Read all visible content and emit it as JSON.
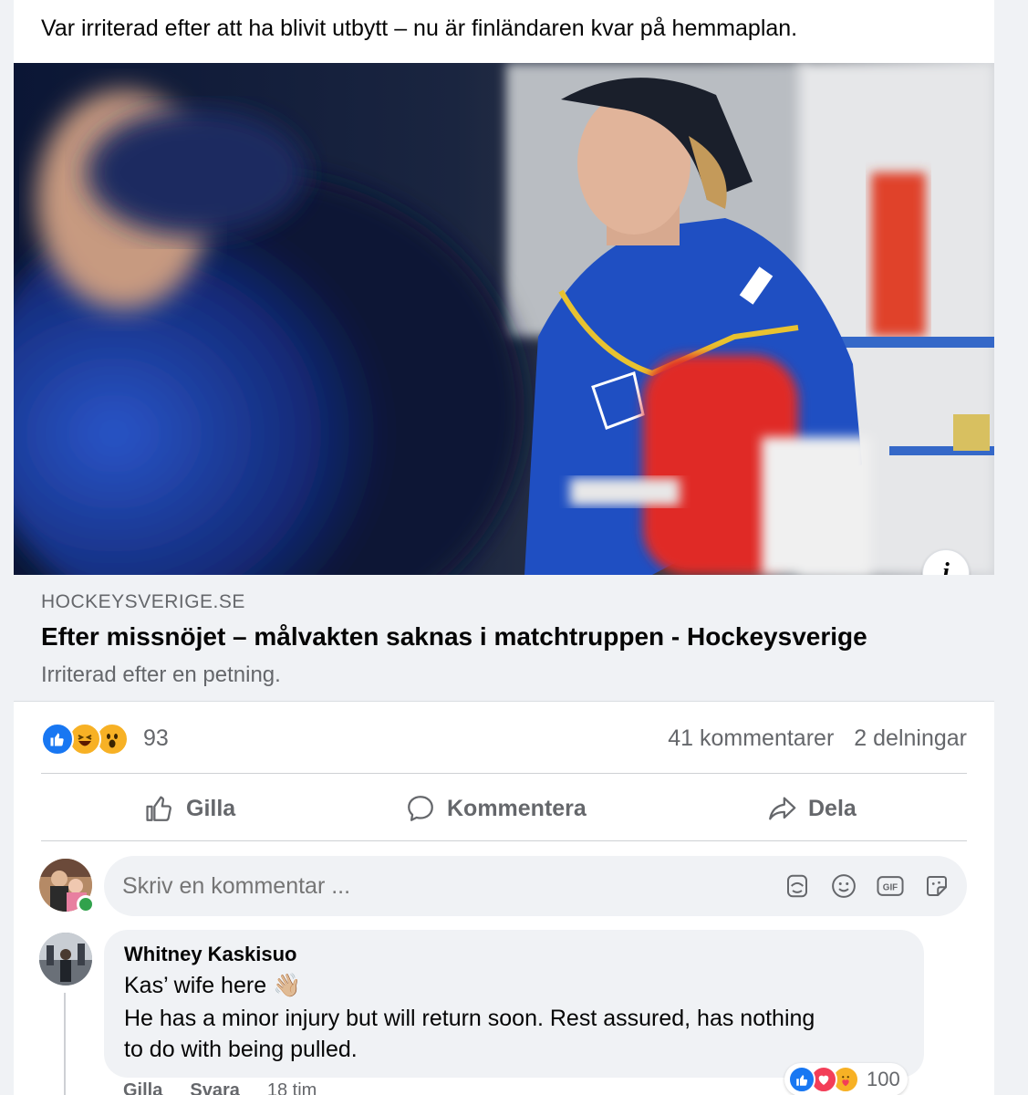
{
  "post": {
    "text": "Var irriterad efter att ha blivit utbytt – nu är finländaren kvar på hemmaplan."
  },
  "link": {
    "domain": "HOCKEYSVERIGE.SE",
    "title": "Efter missnöjet – målvakten saknas i matchtruppen - Hockeysverige",
    "description": "Irriterad efter en petning.",
    "info_icon": "i"
  },
  "stats": {
    "reaction_count": "93",
    "comments": "41 kommentarer",
    "shares": "2 delningar"
  },
  "actions": {
    "like": "Gilla",
    "comment": "Kommentera",
    "share": "Dela"
  },
  "composer": {
    "placeholder": "Skriv en kommentar ..."
  },
  "comment": {
    "author": "Whitney Kaskisuo",
    "line1": "Kas’ wife here 👋🏼",
    "line2": "He has a minor injury but will return soon. Rest assured, has nothing",
    "line3": "to do with being pulled.",
    "reaction_count": "100",
    "like_label": "Gilla",
    "reply_label": "Svara",
    "time": "18 tim"
  },
  "colors": {
    "like_blue": "#1877f2",
    "love_red": "#f33e58",
    "care_yellow": "#f7b125",
    "muted_text": "#65676b",
    "online_green": "#31a24c"
  }
}
